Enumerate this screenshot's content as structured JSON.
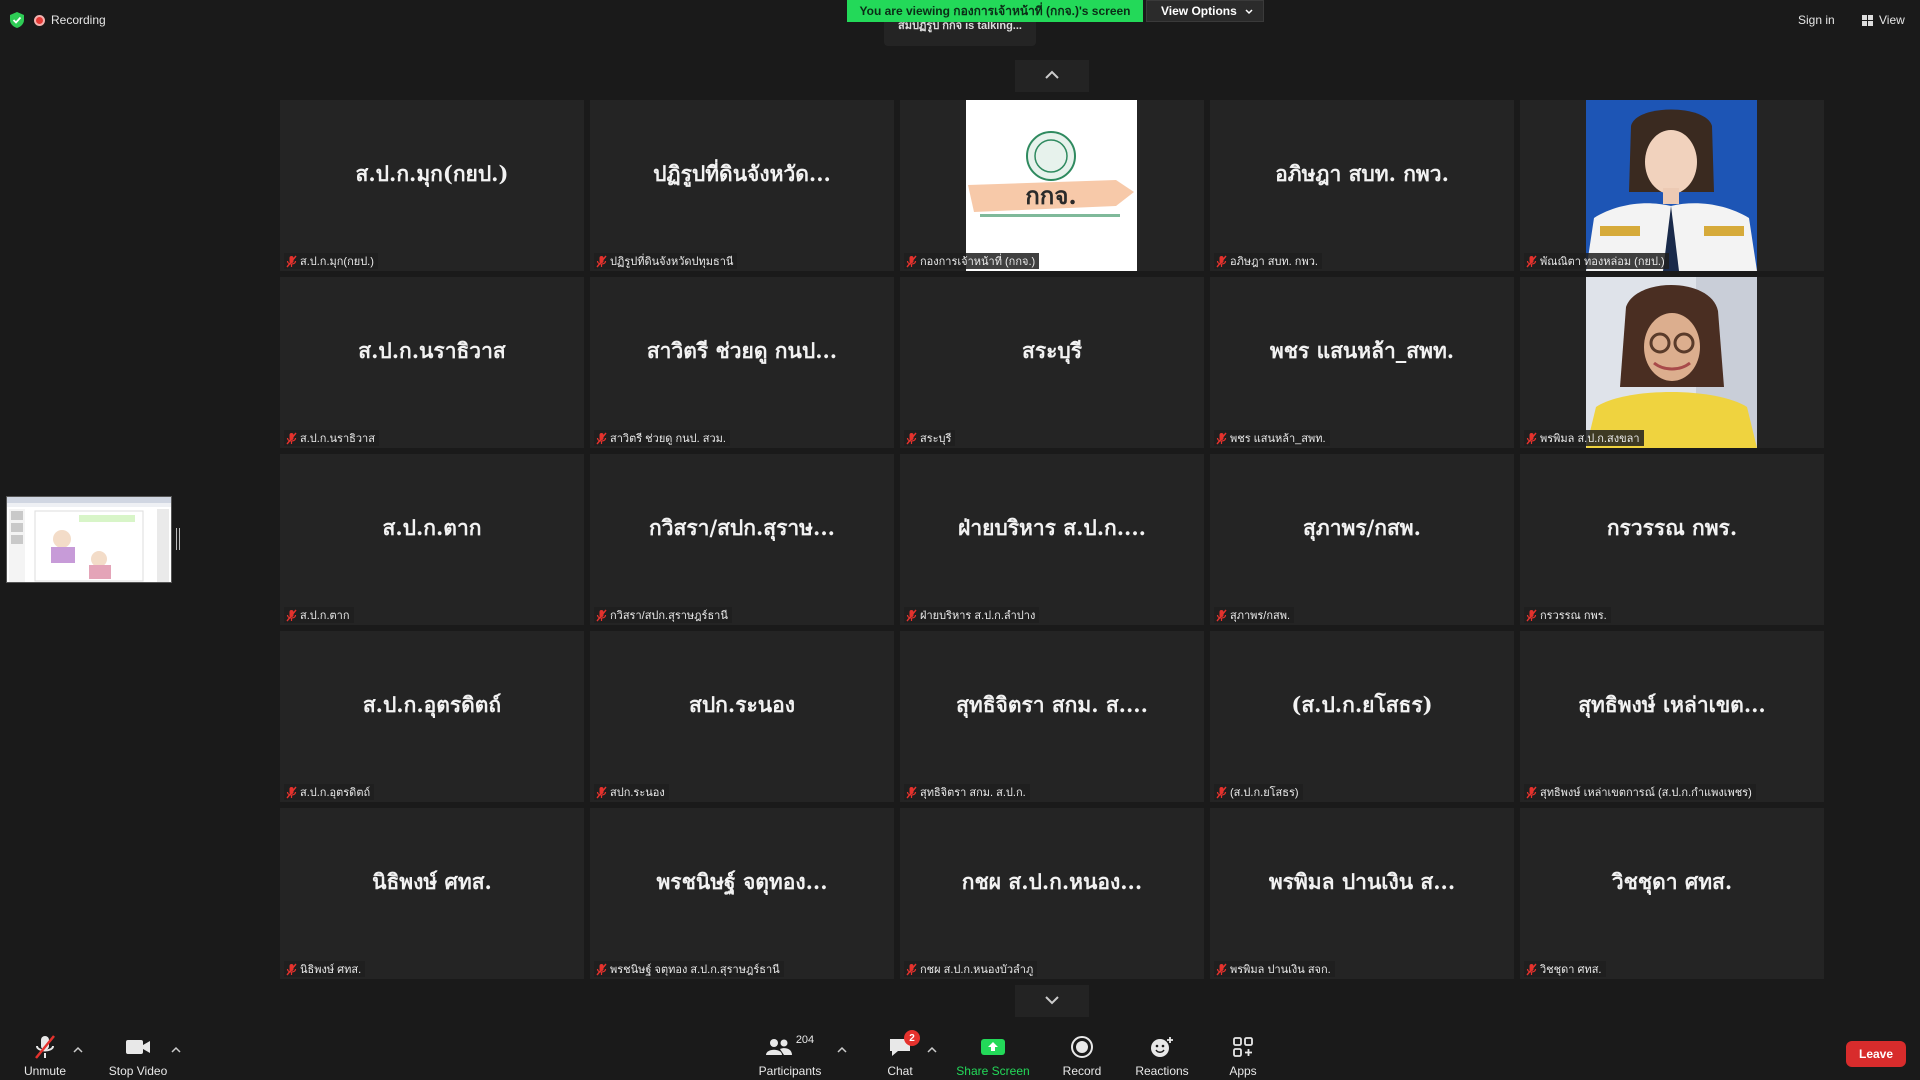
{
  "top": {
    "recording_label": "Recording",
    "viewing_banner": "You are viewing กองการเจ้าหน้าที่ (กกจ.)'s screen",
    "view_options_label": "View Options",
    "talking_text": "สมปฏิรูป กกจ is talking...",
    "sign_in_label": "Sign in",
    "view_label": "View"
  },
  "tiles": [
    {
      "big": "ส.ป.ก.มุก(กยป.)",
      "label": "ส.ป.ก.มุก(กยป.)"
    },
    {
      "big": "ปฏิรูปที่ดินจังหวัด...",
      "label": "ปฏิรูปที่ดินจังหวัดปทุมธานี"
    },
    {
      "big": "",
      "label": "กองการเจ้าหน้าที่ (กกจ.)",
      "photo": "logo",
      "logo_text": "กกจ."
    },
    {
      "big": "อภิษฎา สบท. กพว.",
      "label": "อภิษฎา สบท. กพว."
    },
    {
      "big": "",
      "label": "พัณณิตา ทองหล่อม (กยป.)",
      "photo": "uniform"
    },
    {
      "big": "ส.ป.ก.นราธิวาส",
      "label": "ส.ป.ก.นราธิวาส"
    },
    {
      "big": "สาวิตรี ช่วยดู กนป...",
      "label": "สาวิตรี ช่วยดู กนป. สวม."
    },
    {
      "big": "สระบุรี",
      "label": "สระบุรี"
    },
    {
      "big": "พชร แสนหล้า_สพท.",
      "label": "พชร แสนหล้า_สพท."
    },
    {
      "big": "",
      "label": "พรพิมล ส.ป.ก.สงขลา",
      "photo": "glasses"
    },
    {
      "big": "ส.ป.ก.ตาก",
      "label": "ส.ป.ก.ตาก"
    },
    {
      "big": "กวิสรา/สปก.สุราษ...",
      "label": "กวิสรา/สปก.สุราษฎร์ธานี"
    },
    {
      "big": "ฝ่ายบริหาร ส.ป.ก....",
      "label": "ฝ่ายบริหาร ส.ป.ก.ลำปาง"
    },
    {
      "big": "สุภาพร/กสพ.",
      "label": "สุภาพร/กสพ."
    },
    {
      "big": "กรวรรณ กพร.",
      "label": "กรวรรณ กพร."
    },
    {
      "big": "ส.ป.ก.อุตรดิตถ์",
      "label": "ส.ป.ก.อุตรดิตถ์"
    },
    {
      "big": "สปก.ระนอง",
      "label": "สปก.ระนอง"
    },
    {
      "big": "สุทธิจิตรา สกม. ส....",
      "label": "สุทธิจิตรา สกม. ส.ป.ก."
    },
    {
      "big": "(ส.ป.ก.ยโสธร)",
      "label": "(ส.ป.ก.ยโสธร)"
    },
    {
      "big": "สุทธิพงษ์ เหล่าเขต...",
      "label": "สุทธิพงษ์ เหล่าเขตการณ์ (ส.ป.ก.กำแพงเพชร)"
    },
    {
      "big": "นิธิพงษ์ ศทส.",
      "label": "นิธิพงษ์ ศทส."
    },
    {
      "big": "พรชนิษฐ์ จตุทอง...",
      "label": "พรชนิษฐ์ จตุทอง ส.ป.ก.สุราษฎร์ธานี"
    },
    {
      "big": "กชผ ส.ป.ก.หนอง...",
      "label": "กชผ ส.ป.ก.หนองบัวลำภู"
    },
    {
      "big": "พรพิมล ปานเงิน ส...",
      "label": "พรพิมล ปานเงิน สจก."
    },
    {
      "big": "วิชชุดา ศทส.",
      "label": "วิชชุดา ศทส."
    }
  ],
  "toolbar": {
    "unmute": "Unmute",
    "stop_video": "Stop Video",
    "participants": "Participants",
    "participants_count": "204",
    "chat": "Chat",
    "chat_badge": "2",
    "share_screen": "Share Screen",
    "record": "Record",
    "reactions": "Reactions",
    "apps": "Apps",
    "leave": "Leave"
  },
  "colors": {
    "banner_green": "#23d959",
    "share_green": "#23d959",
    "leave_red": "#d82c2c",
    "mic_red": "#e5322d"
  }
}
